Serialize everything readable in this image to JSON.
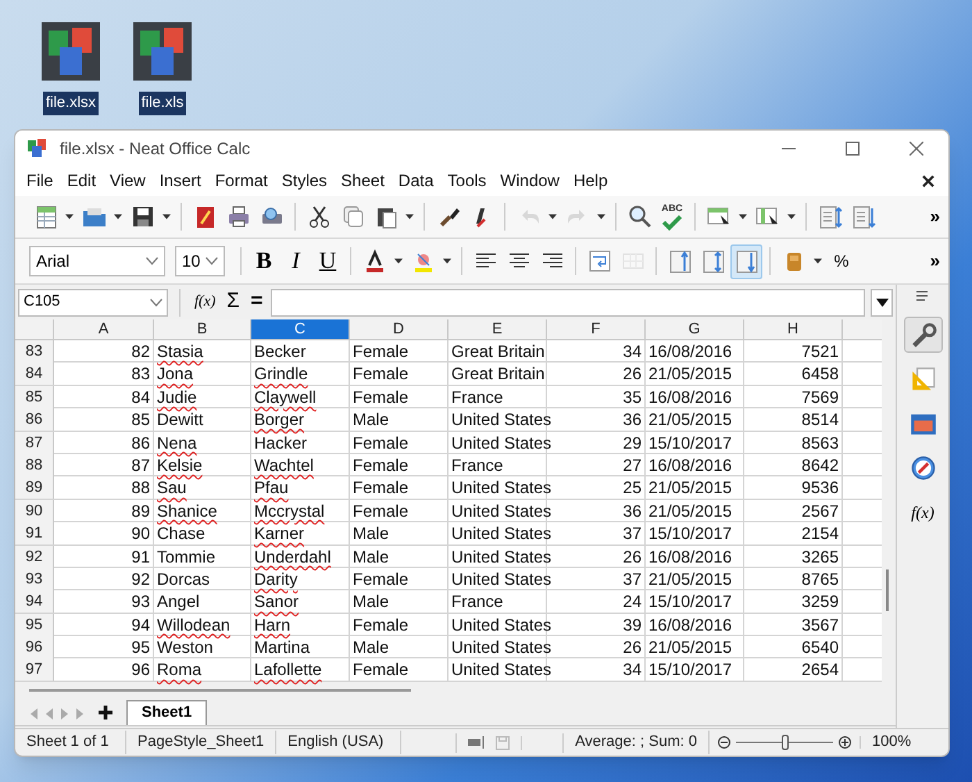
{
  "desktop_icons": [
    {
      "label": "file.xlsx"
    },
    {
      "label": "file.xls"
    }
  ],
  "window": {
    "title": "file.xlsx - Neat Office Calc"
  },
  "menu": [
    {
      "label": "File"
    },
    {
      "label": "Edit"
    },
    {
      "label": "View"
    },
    {
      "label": "Insert"
    },
    {
      "label": "Format"
    },
    {
      "label": "Styles"
    },
    {
      "label": "Sheet"
    },
    {
      "label": "Data"
    },
    {
      "label": "Tools"
    },
    {
      "label": "Window"
    },
    {
      "label": "Help"
    }
  ],
  "toolbar": [
    {
      "kind": "new",
      "dropdown": true
    },
    {
      "kind": "open",
      "dropdown": true
    },
    {
      "kind": "save",
      "dropdown": true
    },
    {
      "kind": "sep"
    },
    {
      "kind": "pdf"
    },
    {
      "kind": "print"
    },
    {
      "kind": "preview"
    },
    {
      "kind": "sep"
    },
    {
      "kind": "cut"
    },
    {
      "kind": "copy"
    },
    {
      "kind": "paste",
      "dropdown": true
    },
    {
      "kind": "sep"
    },
    {
      "kind": "brush"
    },
    {
      "kind": "clear"
    },
    {
      "kind": "sep"
    },
    {
      "kind": "undo",
      "dropdown": true,
      "disabled": true
    },
    {
      "kind": "redo",
      "dropdown": true,
      "disabled": true
    },
    {
      "kind": "sep"
    },
    {
      "kind": "find"
    },
    {
      "kind": "spell",
      "label": "ABC"
    },
    {
      "kind": "sep"
    },
    {
      "kind": "rows",
      "dropdown": true
    },
    {
      "kind": "cols",
      "dropdown": true
    },
    {
      "kind": "sep"
    },
    {
      "kind": "freeze_rows"
    },
    {
      "kind": "freeze_cols"
    }
  ],
  "toolbar_more": "»",
  "format_bar": {
    "font": "Arial",
    "size": "10",
    "items": [
      {
        "kind": "sep"
      },
      {
        "kind": "bold",
        "label": "B"
      },
      {
        "kind": "italic",
        "label": "I"
      },
      {
        "kind": "underline",
        "label": "U"
      },
      {
        "kind": "sep"
      },
      {
        "kind": "fontcolor",
        "dropdown": true
      },
      {
        "kind": "highlight",
        "dropdown": true
      },
      {
        "kind": "sep"
      },
      {
        "kind": "left"
      },
      {
        "kind": "center"
      },
      {
        "kind": "right"
      },
      {
        "kind": "sep"
      },
      {
        "kind": "wrap"
      },
      {
        "kind": "merge",
        "disabled": true
      },
      {
        "kind": "sep"
      },
      {
        "kind": "top"
      },
      {
        "kind": "vcenter"
      },
      {
        "kind": "bottom",
        "selected": true
      },
      {
        "kind": "sep"
      },
      {
        "kind": "currency",
        "dropdown": true
      },
      {
        "kind": "percent",
        "label": "%"
      }
    ],
    "more": "»"
  },
  "formula_bar": {
    "name_box": "C105",
    "function_label": "f(x)",
    "sum_label": "Σ",
    "equals_label": "="
  },
  "columns": [
    {
      "label": "A",
      "kind": "number",
      "selected": false
    },
    {
      "label": "B",
      "kind": "text",
      "selected": false
    },
    {
      "label": "C",
      "kind": "text",
      "selected": true
    },
    {
      "label": "D",
      "kind": "text",
      "selected": false
    },
    {
      "label": "E",
      "kind": "text",
      "selected": false
    },
    {
      "label": "F",
      "kind": "number",
      "selected": false
    },
    {
      "label": "G",
      "kind": "text",
      "selected": false
    },
    {
      "label": "H",
      "kind": "number",
      "selected": false
    }
  ],
  "rows": [
    {
      "header": "83",
      "cells": [
        "82",
        "Stasia",
        "Becker",
        "Female",
        "Great Britain",
        "34",
        "16/08/2016",
        "7521"
      ],
      "misspelled": [
        false,
        true,
        false,
        false,
        false,
        false,
        false,
        false
      ]
    },
    {
      "header": "84",
      "cells": [
        "83",
        "Jona",
        "Grindle",
        "Female",
        "Great Britain",
        "26",
        "21/05/2015",
        "6458"
      ],
      "misspelled": [
        false,
        true,
        true,
        false,
        false,
        false,
        false,
        false
      ]
    },
    {
      "header": "85",
      "cells": [
        "84",
        "Judie",
        "Claywell",
        "Female",
        "France",
        "35",
        "16/08/2016",
        "7569"
      ],
      "misspelled": [
        false,
        true,
        true,
        false,
        false,
        false,
        false,
        false
      ]
    },
    {
      "header": "86",
      "cells": [
        "85",
        "Dewitt",
        "Borger",
        "Male",
        "United States",
        "36",
        "21/05/2015",
        "8514"
      ],
      "misspelled": [
        false,
        false,
        true,
        false,
        false,
        false,
        false,
        false
      ]
    },
    {
      "header": "87",
      "cells": [
        "86",
        "Nena",
        "Hacker",
        "Female",
        "United States",
        "29",
        "15/10/2017",
        "8563"
      ],
      "misspelled": [
        false,
        true,
        false,
        false,
        false,
        false,
        false,
        false
      ]
    },
    {
      "header": "88",
      "cells": [
        "87",
        "Kelsie",
        "Wachtel",
        "Female",
        "France",
        "27",
        "16/08/2016",
        "8642"
      ],
      "misspelled": [
        false,
        true,
        true,
        false,
        false,
        false,
        false,
        false
      ]
    },
    {
      "header": "89",
      "cells": [
        "88",
        "Sau",
        "Pfau",
        "Female",
        "United States",
        "25",
        "21/05/2015",
        "9536"
      ],
      "misspelled": [
        false,
        true,
        true,
        false,
        false,
        false,
        false,
        false
      ]
    },
    {
      "header": "90",
      "cells": [
        "89",
        "Shanice",
        "Mccrystal",
        "Female",
        "United States",
        "36",
        "21/05/2015",
        "2567"
      ],
      "misspelled": [
        false,
        true,
        true,
        false,
        false,
        false,
        false,
        false
      ]
    },
    {
      "header": "91",
      "cells": [
        "90",
        "Chase",
        "Karner",
        "Male",
        "United States",
        "37",
        "15/10/2017",
        "2154"
      ],
      "misspelled": [
        false,
        false,
        true,
        false,
        false,
        false,
        false,
        false
      ]
    },
    {
      "header": "92",
      "cells": [
        "91",
        "Tommie",
        "Underdahl",
        "Male",
        "United States",
        "26",
        "16/08/2016",
        "3265"
      ],
      "misspelled": [
        false,
        false,
        true,
        false,
        false,
        false,
        false,
        false
      ]
    },
    {
      "header": "93",
      "cells": [
        "92",
        "Dorcas",
        "Darity",
        "Female",
        "United States",
        "37",
        "21/05/2015",
        "8765"
      ],
      "misspelled": [
        false,
        false,
        true,
        false,
        false,
        false,
        false,
        false
      ]
    },
    {
      "header": "94",
      "cells": [
        "93",
        "Angel",
        "Sanor",
        "Male",
        "France",
        "24",
        "15/10/2017",
        "3259"
      ],
      "misspelled": [
        false,
        false,
        true,
        false,
        false,
        false,
        false,
        false
      ]
    },
    {
      "header": "95",
      "cells": [
        "94",
        "Willodean",
        "Harn",
        "Female",
        "United States",
        "39",
        "16/08/2016",
        "3567"
      ],
      "misspelled": [
        false,
        true,
        true,
        false,
        false,
        false,
        false,
        false
      ]
    },
    {
      "header": "96",
      "cells": [
        "95",
        "Weston",
        "Martina",
        "Male",
        "United States",
        "26",
        "21/05/2015",
        "6540"
      ],
      "misspelled": [
        false,
        false,
        false,
        false,
        false,
        false,
        false,
        false
      ]
    },
    {
      "header": "97",
      "cells": [
        "96",
        "Roma",
        "Lafollette",
        "Female",
        "United States",
        "34",
        "15/10/2017",
        "2654"
      ],
      "misspelled": [
        false,
        true,
        true,
        false,
        false,
        false,
        false,
        false
      ]
    }
  ],
  "sidebar": [
    {
      "kind": "properties",
      "selected": true
    },
    {
      "kind": "styles",
      "selected": false
    },
    {
      "kind": "gallery",
      "selected": false
    },
    {
      "kind": "navigator",
      "selected": false
    },
    {
      "kind": "functions",
      "label": "f(x)",
      "selected": false
    }
  ],
  "sheet_tabs": [
    {
      "label": "Sheet1",
      "selected": true
    }
  ],
  "status_bar": {
    "sheet": "Sheet 1 of 1",
    "page_style": "PageStyle_Sheet1",
    "language": "English (USA)",
    "summary": "Average: ; Sum: 0",
    "zoom": {
      "level": 0.5,
      "reading": "100%"
    }
  }
}
